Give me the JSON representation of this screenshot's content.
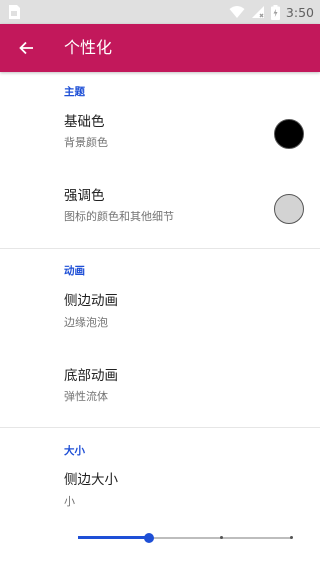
{
  "status_bar": {
    "time": "3:50",
    "icons": [
      "sim-card-icon",
      "wifi-icon",
      "no-signal-icon",
      "battery-charging-icon"
    ]
  },
  "app_bar": {
    "back_icon": "arrow-back-icon",
    "title": "个性化",
    "color": "#c2185b"
  },
  "sections": {
    "theme": {
      "header": "主题",
      "base_color": {
        "title": "基础色",
        "summary": "背景颜色",
        "swatch_color": "#000000"
      },
      "accent_color": {
        "title": "强调色",
        "summary": "图标的颜色和其他细节",
        "swatch_color": "#d3d3d3"
      }
    },
    "animation": {
      "header": "动画",
      "side_animation": {
        "title": "侧边动画",
        "summary": "边缘泡泡"
      },
      "bottom_animation": {
        "title": "底部动画",
        "summary": "弹性流体"
      }
    },
    "size": {
      "header": "大小",
      "side_size": {
        "title": "侧边大小",
        "summary": "小"
      },
      "slider": {
        "steps": 4,
        "value_index": 1,
        "fraction": 0.333
      }
    }
  },
  "accent": "#1e4fd6"
}
